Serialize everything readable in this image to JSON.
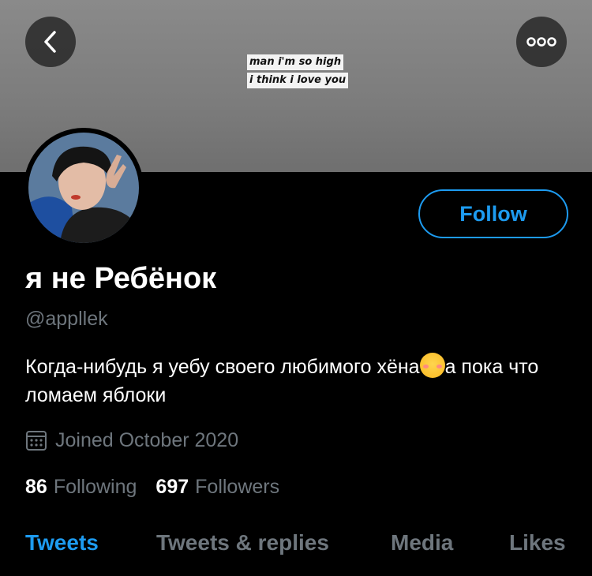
{
  "banner": {
    "line1": "man i'm so high",
    "line2": "i think i love you"
  },
  "header": {
    "back_icon": "chevron-left-icon",
    "more_icon": "more-horizontal-icon"
  },
  "profile": {
    "follow_label": "Follow",
    "display_name": "я не Ребёнок",
    "handle": "@appllek",
    "bio_part1": "Когда-нибудь я уебу своего любимого хёна",
    "bio_emoji": "smiling-face-with-hearts-emoji",
    "bio_part2": "а пока что ломаем яблоки",
    "joined": "Joined October 2020",
    "following_count": "86",
    "following_label": "Following",
    "followers_count": "697",
    "followers_label": "Followers"
  },
  "tabs": [
    {
      "label": "Tweets",
      "active": true
    },
    {
      "label": "Tweets & replies",
      "active": false
    },
    {
      "label": "Media",
      "active": false
    },
    {
      "label": "Likes",
      "active": false
    }
  ],
  "colors": {
    "accent": "#1d9bf0",
    "muted": "#6e767d",
    "background": "#000000"
  }
}
